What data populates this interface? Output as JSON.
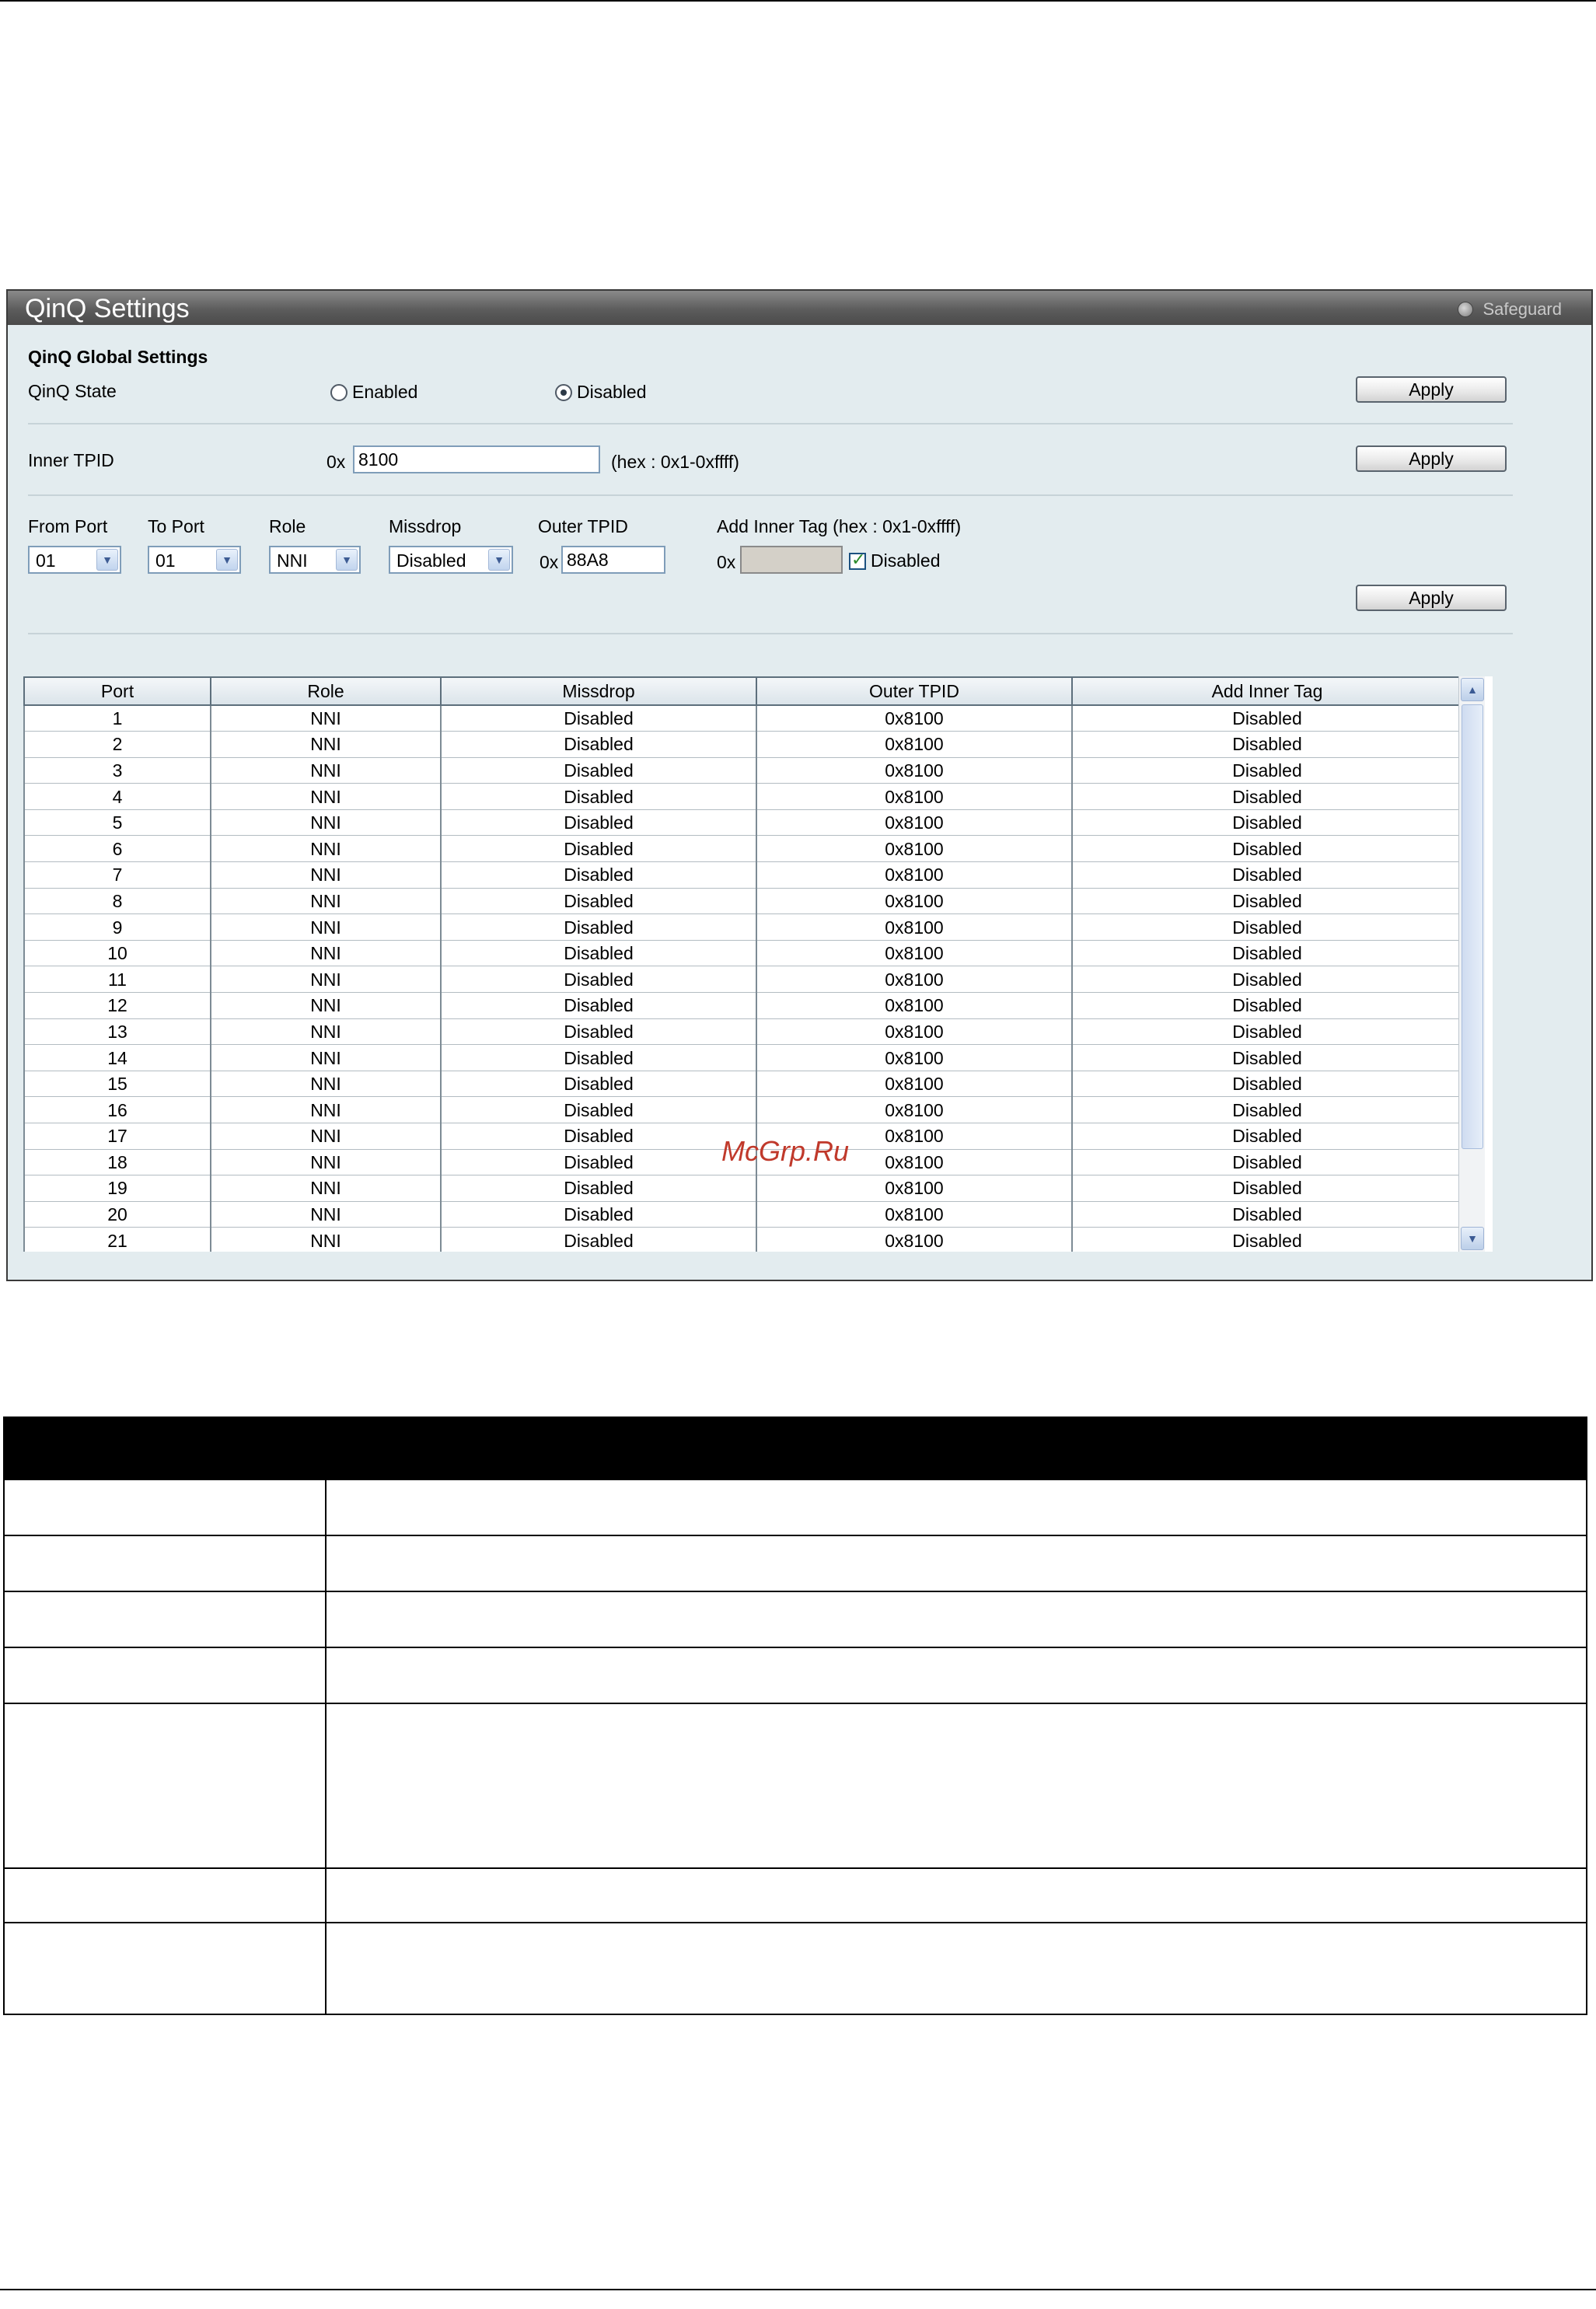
{
  "panel": {
    "title": "QinQ Settings",
    "safeguard": "Safeguard",
    "global": {
      "heading": "QinQ Global Settings",
      "state_label": "QinQ State",
      "enabled_label": "Enabled",
      "disabled_label": "Disabled",
      "selected": "Disabled",
      "apply_label": "Apply"
    },
    "inner_tpid": {
      "label": "Inner TPID",
      "prefix": "0x",
      "value": "8100",
      "hint": "(hex : 0x1-0xffff)",
      "apply_label": "Apply"
    },
    "port_settings": {
      "from_port_label": "From Port",
      "from_port_value": "01",
      "to_port_label": "To Port",
      "to_port_value": "01",
      "role_label": "Role",
      "role_value": "NNI",
      "missdrop_label": "Missdrop",
      "missdrop_value": "Disabled",
      "outer_tpid_label": "Outer TPID",
      "outer_tpid_prefix": "0x",
      "outer_tpid_value": "88A8",
      "add_inner_tag_label": "Add Inner Tag (hex : 0x1-0xffff)",
      "add_inner_tag_prefix": "0x",
      "add_inner_tag_value": "",
      "disabled_checkbox_label": "Disabled",
      "disabled_checked": true,
      "apply_label": "Apply"
    },
    "table": {
      "columns": [
        "Port",
        "Role",
        "Missdrop",
        "Outer TPID",
        "Add Inner Tag"
      ],
      "rows": [
        [
          "1",
          "NNI",
          "Disabled",
          "0x8100",
          "Disabled"
        ],
        [
          "2",
          "NNI",
          "Disabled",
          "0x8100",
          "Disabled"
        ],
        [
          "3",
          "NNI",
          "Disabled",
          "0x8100",
          "Disabled"
        ],
        [
          "4",
          "NNI",
          "Disabled",
          "0x8100",
          "Disabled"
        ],
        [
          "5",
          "NNI",
          "Disabled",
          "0x8100",
          "Disabled"
        ],
        [
          "6",
          "NNI",
          "Disabled",
          "0x8100",
          "Disabled"
        ],
        [
          "7",
          "NNI",
          "Disabled",
          "0x8100",
          "Disabled"
        ],
        [
          "8",
          "NNI",
          "Disabled",
          "0x8100",
          "Disabled"
        ],
        [
          "9",
          "NNI",
          "Disabled",
          "0x8100",
          "Disabled"
        ],
        [
          "10",
          "NNI",
          "Disabled",
          "0x8100",
          "Disabled"
        ],
        [
          "11",
          "NNI",
          "Disabled",
          "0x8100",
          "Disabled"
        ],
        [
          "12",
          "NNI",
          "Disabled",
          "0x8100",
          "Disabled"
        ],
        [
          "13",
          "NNI",
          "Disabled",
          "0x8100",
          "Disabled"
        ],
        [
          "14",
          "NNI",
          "Disabled",
          "0x8100",
          "Disabled"
        ],
        [
          "15",
          "NNI",
          "Disabled",
          "0x8100",
          "Disabled"
        ],
        [
          "16",
          "NNI",
          "Disabled",
          "0x8100",
          "Disabled"
        ],
        [
          "17",
          "NNI",
          "Disabled",
          "0x8100",
          "Disabled"
        ],
        [
          "18",
          "NNI",
          "Disabled",
          "0x8100",
          "Disabled"
        ],
        [
          "19",
          "NNI",
          "Disabled",
          "0x8100",
          "Disabled"
        ],
        [
          "20",
          "NNI",
          "Disabled",
          "0x8100",
          "Disabled"
        ],
        [
          "21",
          "NNI",
          "Disabled",
          "0x8100",
          "Disabled"
        ]
      ]
    }
  },
  "watermark": "McGrp.Ru",
  "colors": {
    "panel_bg": "#e3ecef",
    "title_bar": "#5c5c5c",
    "desc_header": "#000000"
  }
}
